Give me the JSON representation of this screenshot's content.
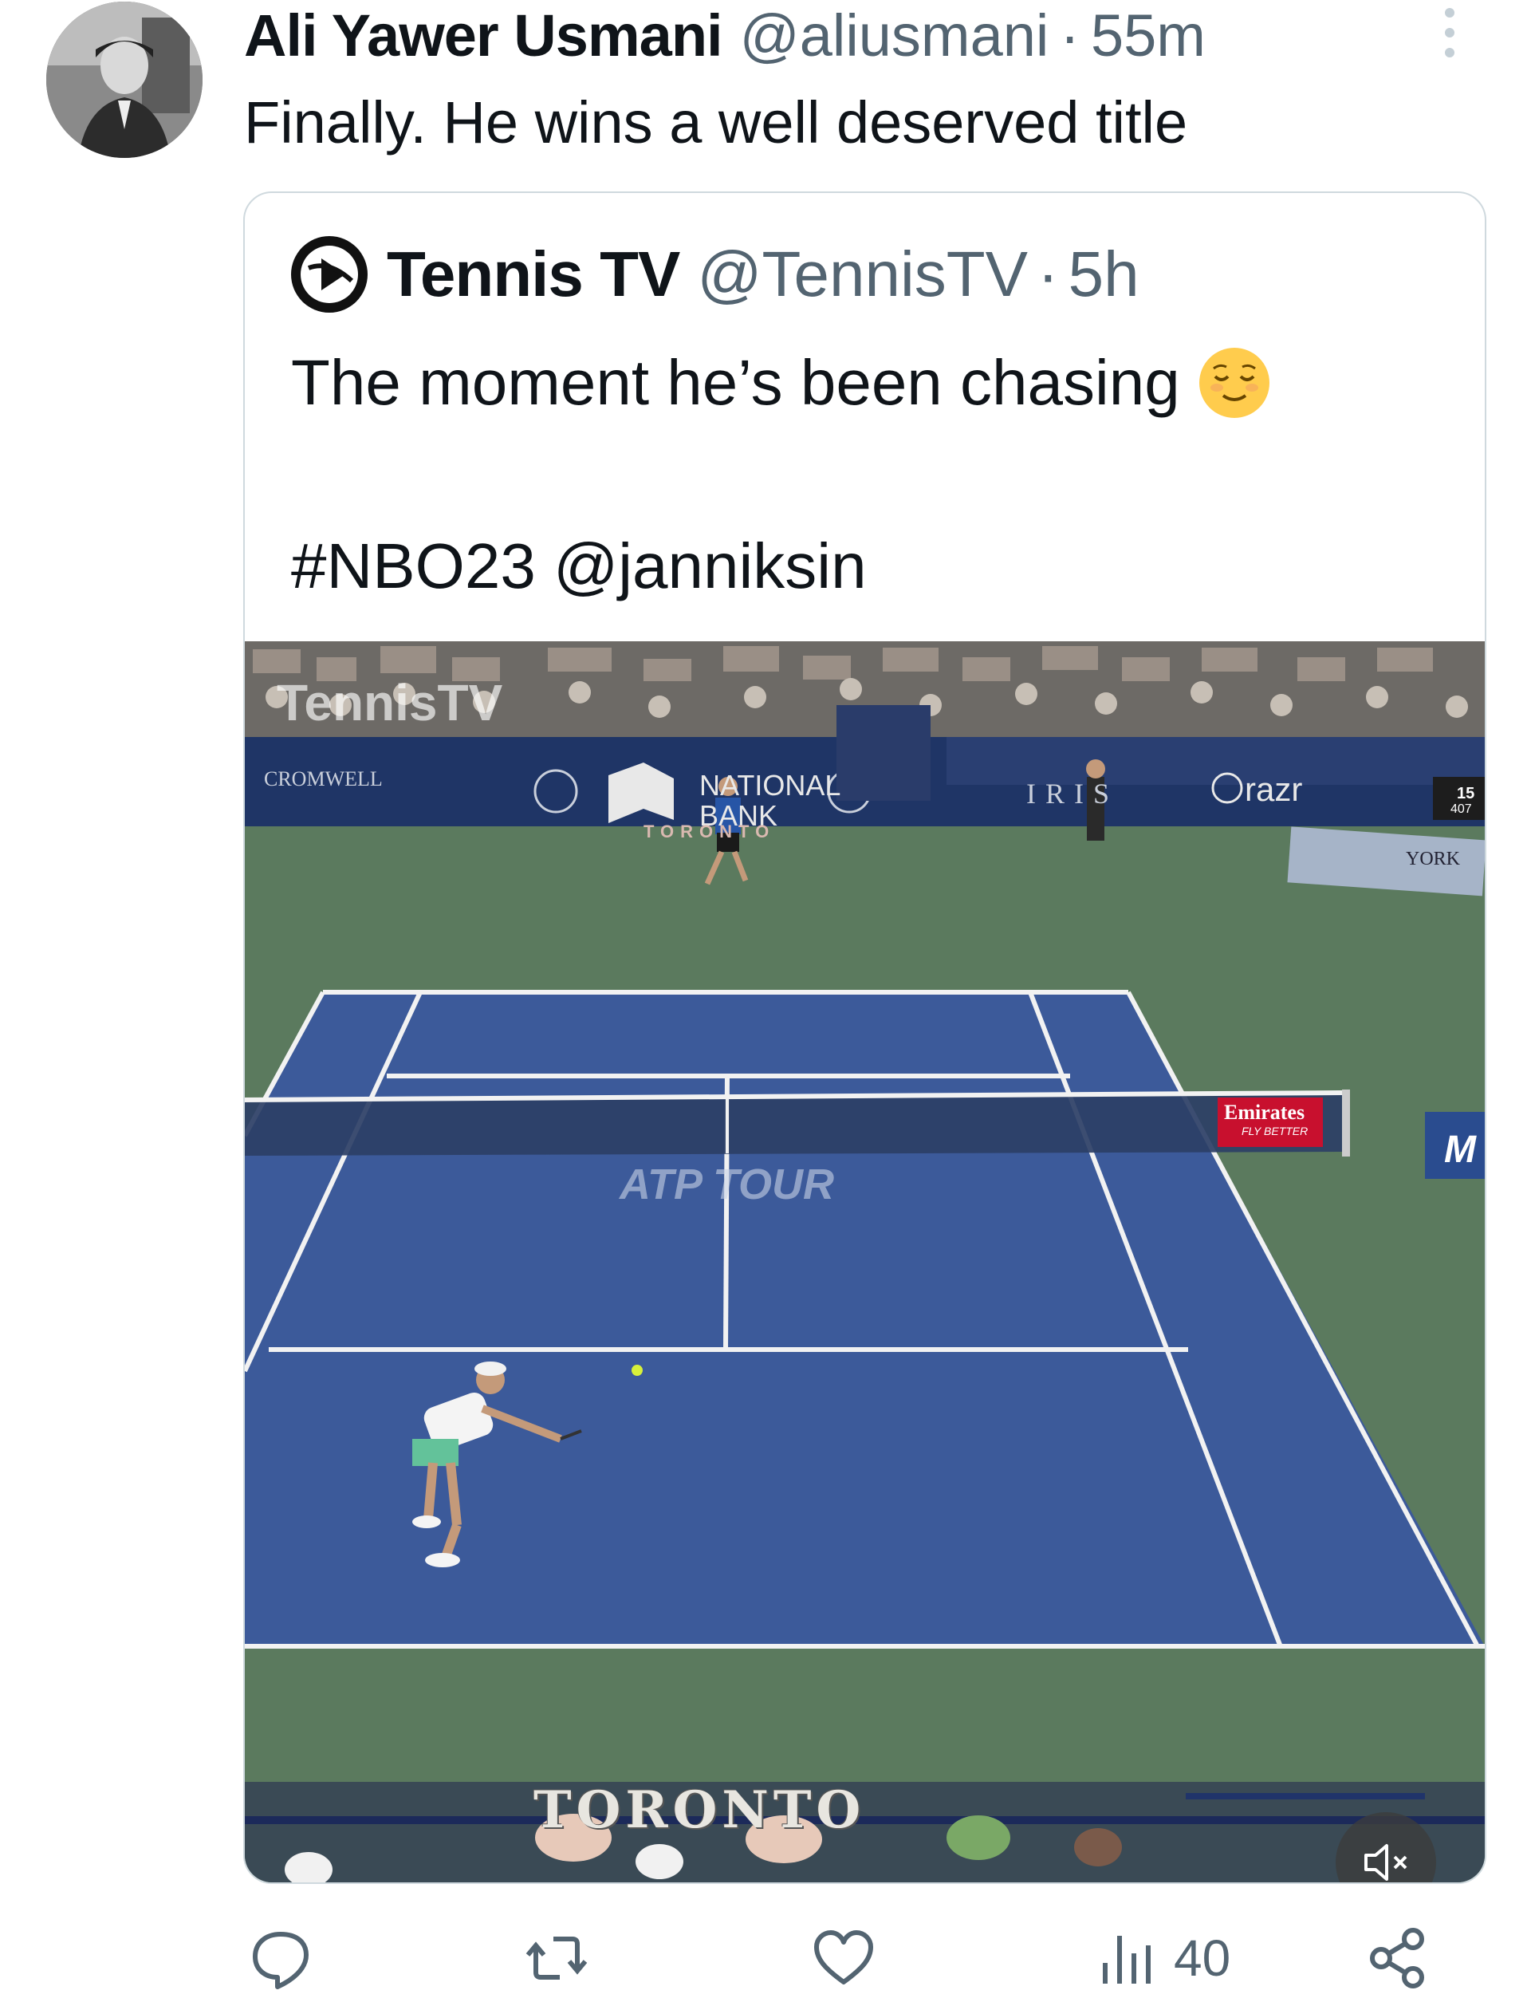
{
  "tweet": {
    "display_name": "Ali Yawer Usmani",
    "handle": "@aliusmani",
    "separator": "·",
    "time": "55m",
    "text": "Finally. He wins a well deserved title"
  },
  "quoted": {
    "display_name": "Tennis TV",
    "handle": "@TennisTV",
    "separator": "·",
    "time": "5h",
    "text_line1": "The moment he’s been chasing",
    "emoji_icon": "relieved-face-icon",
    "text_line2": "#NBO23 @janniksin"
  },
  "media": {
    "watermark": "TennisTV",
    "signs": {
      "cromwell": "CROMWELL",
      "national_bank_1": "NATIONAL",
      "national_bank_2": "BANK",
      "iris": "IRIS",
      "razr": "razr",
      "york": "YORK",
      "emirates": "Emirates",
      "emirates_sub": "FLY BETTER",
      "atp": "ATP TOUR",
      "toronto_court": "TORONTO",
      "toronto_bottom": "TORONTO",
      "scoreboard_15": "15",
      "scoreboard_407": "407",
      "m_sign": "M"
    },
    "mute_icon": "speaker-muted-icon",
    "colors": {
      "court_blue": "#3c5a9a",
      "outer_green": "#5b7a5e",
      "wall": "#1f3566"
    }
  },
  "actions": {
    "reply_icon": "reply-icon",
    "retweet_icon": "retweet-icon",
    "like_icon": "heart-icon",
    "views_icon": "views-icon",
    "views_count": "40",
    "share_icon": "share-icon"
  }
}
